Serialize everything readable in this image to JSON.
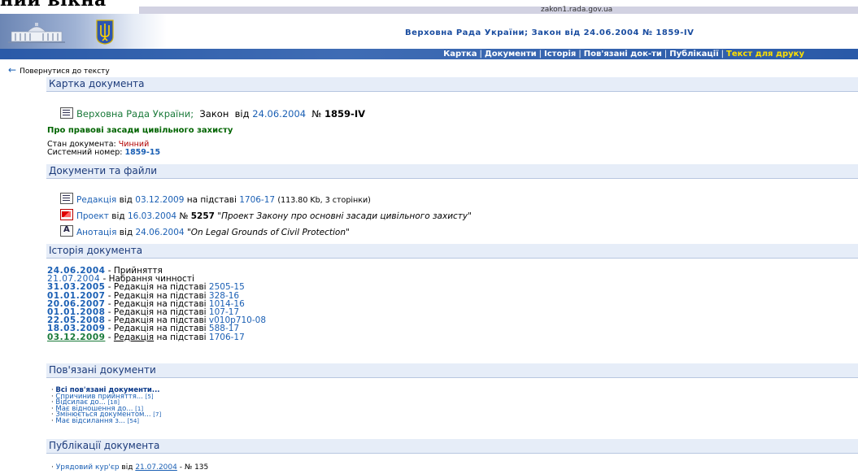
{
  "cut_title": "ний вікна",
  "domain": "zakon1.rada.gov.ua",
  "header": {
    "title": "Верховна Рада України; Закон від 24.06.2004 № 1859-IV"
  },
  "nav": {
    "items": [
      "Картка",
      "Документи",
      "Історія",
      "Пов'язані док-ти",
      "Публікації",
      "Текст для друку"
    ],
    "active_index": 5
  },
  "back_link": "Повернутися до тексту",
  "card": {
    "section": "Картка документа",
    "issuer": "Верховна Рада України;",
    "type": "Закон",
    "from_word": "від",
    "date": "24.06.2004",
    "num_label": "№",
    "number": "1859-IV",
    "subject": "Про правові засади цивільного захисту",
    "status_label": "Стан документа:",
    "status_value": "Чинний",
    "sys_label": "Системний номер:",
    "sys_value": "1859-15"
  },
  "docs": {
    "section": "Документи та файли",
    "rows": [
      {
        "icon": "word-doc-icon",
        "link": "Редакція",
        "w1": "від",
        "date": "03.12.2009",
        "w2": "на підставі",
        "ref": "1706-17",
        "extra": "(113.80 Kb, 3 сторінки)"
      },
      {
        "icon": "pdf-icon",
        "link": "Проект",
        "w1": "від",
        "date": "16.03.2004",
        "w2": "№",
        "ref": "5257",
        "extra": "\"Проект Закону про основні засади цивільного захисту\""
      },
      {
        "icon": "annotation-icon",
        "link": "Анотація",
        "w1": "від",
        "date": "24.06.2004",
        "w2": "",
        "ref": "",
        "extra": "\"On Legal Grounds of Civil Protection\""
      }
    ]
  },
  "history": {
    "section": "Історія документа",
    "rows": [
      {
        "date": "24.06.2004",
        "text": " - Прийняття",
        "link": ""
      },
      {
        "date": "21.07.2004",
        "text": " - Набрання чинності",
        "link": ""
      },
      {
        "date": "31.03.2005",
        "text": " - Редакція на підставі ",
        "link": "2505-15"
      },
      {
        "date": "01.01.2007",
        "text": " - Редакція на підставі ",
        "link": "328-16"
      },
      {
        "date": "20.06.2007",
        "text": " - Редакція на підставі ",
        "link": "1014-16"
      },
      {
        "date": "01.01.2008",
        "text": " - Редакція на підставі ",
        "link": "107-17"
      },
      {
        "date": "22.05.2008",
        "text": " - Редакція на підставі ",
        "link": "v010p710-08"
      },
      {
        "date": "18.03.2009",
        "text": " - Редакція на підставі ",
        "link": "588-17"
      },
      {
        "date": "03.12.2009",
        "text": " - ",
        "link": "1706-17",
        "current": "Редакція",
        "mid": " на підставі "
      }
    ]
  },
  "related": {
    "section": "Пов'язані документи",
    "items": [
      {
        "label": "Всі пов'язані документи...",
        "count": ""
      },
      {
        "label": "Спричинив прийняття...",
        "count": "[5]"
      },
      {
        "label": "Відсилає до...",
        "count": "[18]"
      },
      {
        "label": "Має відношення до...",
        "count": "[1]"
      },
      {
        "label": "Змінюється документом...",
        "count": "[7]"
      },
      {
        "label": "Має відсилання з...",
        "count": "[54]"
      }
    ]
  },
  "publications": {
    "section": "Публікації документа",
    "items": [
      {
        "source": "Урядовий кур'єр",
        "w1": "від",
        "date": "21.07.2004",
        "num": "- № 135"
      }
    ]
  }
}
